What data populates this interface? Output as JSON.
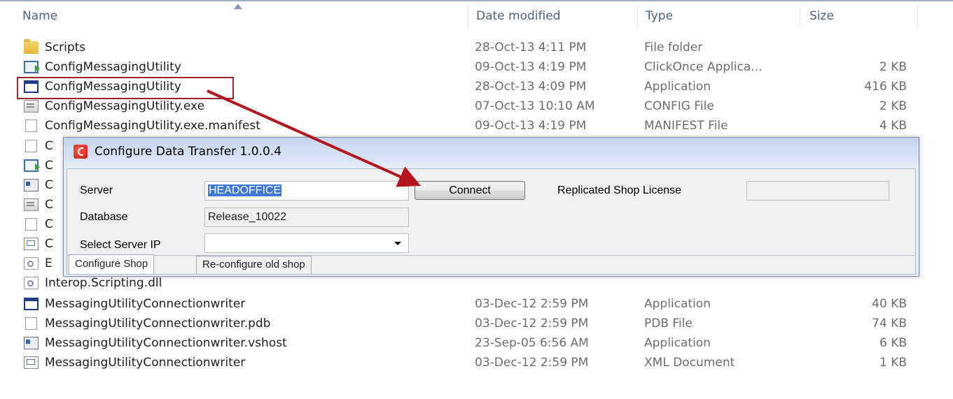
{
  "columns": {
    "name": "Name",
    "date": "Date modified",
    "type": "Type",
    "size": "Size"
  },
  "files": [
    {
      "icon": "folder-icon",
      "name": "Scripts",
      "date": "28-Oct-13 4:11 PM",
      "type": "File folder",
      "size": ""
    },
    {
      "icon": "clickonce-icon",
      "name": "ConfigMessagingUtility",
      "date": "09-Oct-13 4:19 PM",
      "type": "ClickOnce Applica...",
      "size": "2 KB"
    },
    {
      "icon": "application-icon",
      "name": "ConfigMessagingUtility",
      "date": "28-Oct-13 4:09 PM",
      "type": "Application",
      "size": "416 KB"
    },
    {
      "icon": "config-file-icon",
      "name": "ConfigMessagingUtility.exe",
      "date": "07-Oct-13 10:10 AM",
      "type": "CONFIG File",
      "size": "2 KB"
    },
    {
      "icon": "document-icon",
      "name": "ConfigMessagingUtility.exe.manifest",
      "date": "09-Oct-13 4:19 PM",
      "type": "MANIFEST File",
      "size": "4 KB"
    },
    {
      "icon": "document-icon",
      "name": "C"
    },
    {
      "icon": "clickonce-icon",
      "name": "C"
    },
    {
      "icon": "vshost-icon",
      "name": "C"
    },
    {
      "icon": "config-file-icon",
      "name": "C"
    },
    {
      "icon": "document-icon",
      "name": "C"
    },
    {
      "icon": "xml-document-icon",
      "name": "C"
    },
    {
      "icon": "dll-icon",
      "name": "E"
    },
    {
      "icon": "dll-icon",
      "name": "Interop.Scripting.dll"
    },
    {
      "icon": "application-icon",
      "name": "MessagingUtilityConnectionwriter",
      "date": "03-Dec-12 2:59 PM",
      "type": "Application",
      "size": "40 KB"
    },
    {
      "icon": "document-icon",
      "name": "MessagingUtilityConnectionwriter.pdb",
      "date": "03-Dec-12 2:59 PM",
      "type": "PDB File",
      "size": "74 KB"
    },
    {
      "icon": "vshost-icon",
      "name": "MessagingUtilityConnectionwriter.vshost",
      "date": "23-Sep-05 6:56 AM",
      "type": "Application",
      "size": "6 KB"
    },
    {
      "icon": "xml-document-icon",
      "name": "MessagingUtilityConnectionwriter",
      "date": "03-Dec-12 2:59 PM",
      "type": "XML Document",
      "size": "1 KB"
    }
  ],
  "dialog": {
    "title": "Configure Data Transfer 1.0.0.4",
    "server_label": "Server",
    "server_value": "HEADOFFICE",
    "connect_label": "Connect",
    "license_label": "Replicated Shop License",
    "license_value": "",
    "database_label": "Database",
    "database_value": "Release_10022",
    "server_ip_label": "Select Server IP",
    "server_ip_value": "",
    "tabs": [
      "Configure Shop",
      "Re-configure old shop"
    ]
  },
  "annotation": {
    "arrow_color": "#b5161b",
    "highlight_color": "#a0262a"
  }
}
